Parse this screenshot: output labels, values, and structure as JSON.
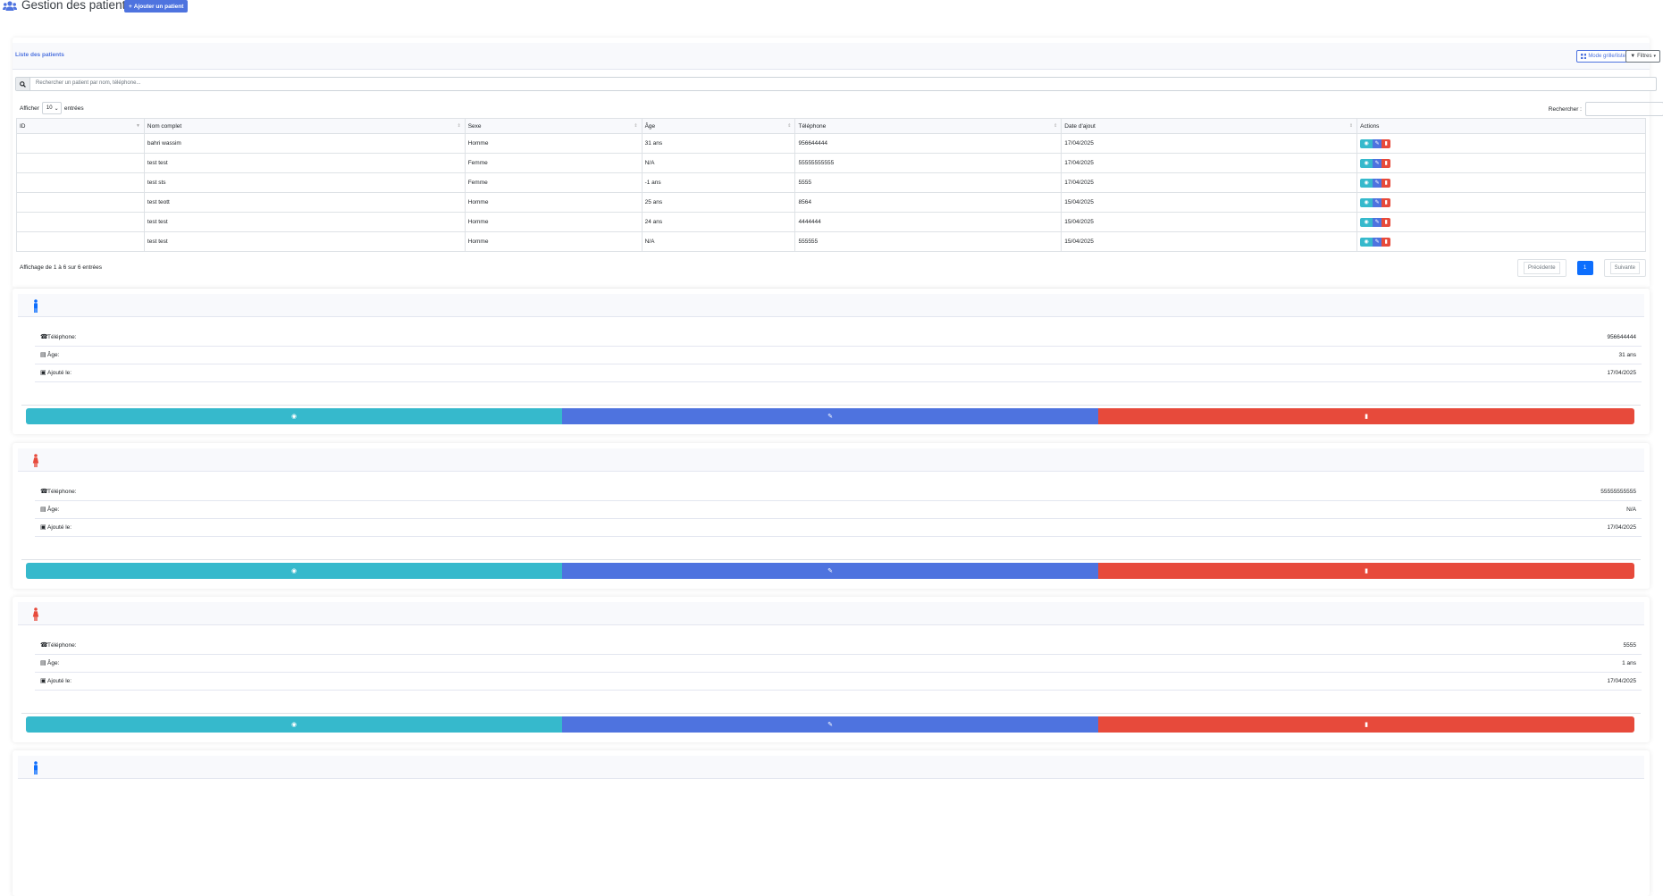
{
  "header": {
    "title": "Gestion des patients",
    "add_button": "Ajouter un patient"
  },
  "list": {
    "title": "Liste des patients",
    "grid_button": "Mode grille/liste",
    "filter_button": "Filtres",
    "search_placeholder": "Rechercher un patient par nom, téléphone...",
    "show_label": "Afficher",
    "show_value": "10",
    "entries_label": "entrées",
    "search_label": "Rechercher :",
    "columns": [
      "ID",
      "Nom complet",
      "Sexe",
      "Âge",
      "Téléphone",
      "Date d'ajout",
      "Actions"
    ],
    "rows": [
      {
        "id": "",
        "name": "bahri wassim",
        "sex": "Homme",
        "age": "31 ans",
        "phone": "956644444",
        "date": "17/04/2025"
      },
      {
        "id": "",
        "name": "test test",
        "sex": "Femme",
        "age": "N/A",
        "phone": "55555555555",
        "date": "17/04/2025"
      },
      {
        "id": "",
        "name": "test sts",
        "sex": "Femme",
        "age": "-1 ans",
        "phone": "5555",
        "date": "17/04/2025"
      },
      {
        "id": "",
        "name": "test teott",
        "sex": "Homme",
        "age": "25 ans",
        "phone": "8564",
        "date": "15/04/2025"
      },
      {
        "id": "",
        "name": "test test",
        "sex": "Homme",
        "age": "24 ans",
        "phone": "4444444",
        "date": "15/04/2025"
      },
      {
        "id": "",
        "name": "test test",
        "sex": "Homme",
        "age": "N/A",
        "phone": "555555",
        "date": "15/04/2025"
      }
    ],
    "info": "Affichage de 1 à 6 sur 6 entrées",
    "prev": "Précédente",
    "page": "1",
    "next": "Suivante"
  },
  "cards": [
    {
      "gender": "male",
      "phone": "956644444",
      "age": "31 ans",
      "added": "17/04/2025"
    },
    {
      "gender": "female",
      "phone": "55555555555",
      "age": "N/A",
      "added": "17/04/2025"
    },
    {
      "gender": "female",
      "phone": "5555",
      "age": "1 ans",
      "added": "17/04/2025"
    },
    {
      "gender": "male"
    }
  ],
  "card_labels": {
    "phone": "Téléphone:",
    "age": "Âge:",
    "added": "Ajouté le:"
  },
  "colors": {
    "primary": "#4e73df",
    "info": "#36b9cc",
    "danger": "#e74a3b",
    "male": "#0d6efd",
    "female": "#e74a3b"
  },
  "icons": {
    "header": "users-icon",
    "view": "eye-icon",
    "edit": "edit-icon",
    "delete": "trash-icon",
    "phone": "phone-icon",
    "age": "birthday-icon",
    "added": "calendar-icon",
    "male": "male-icon",
    "female": "female-icon"
  }
}
